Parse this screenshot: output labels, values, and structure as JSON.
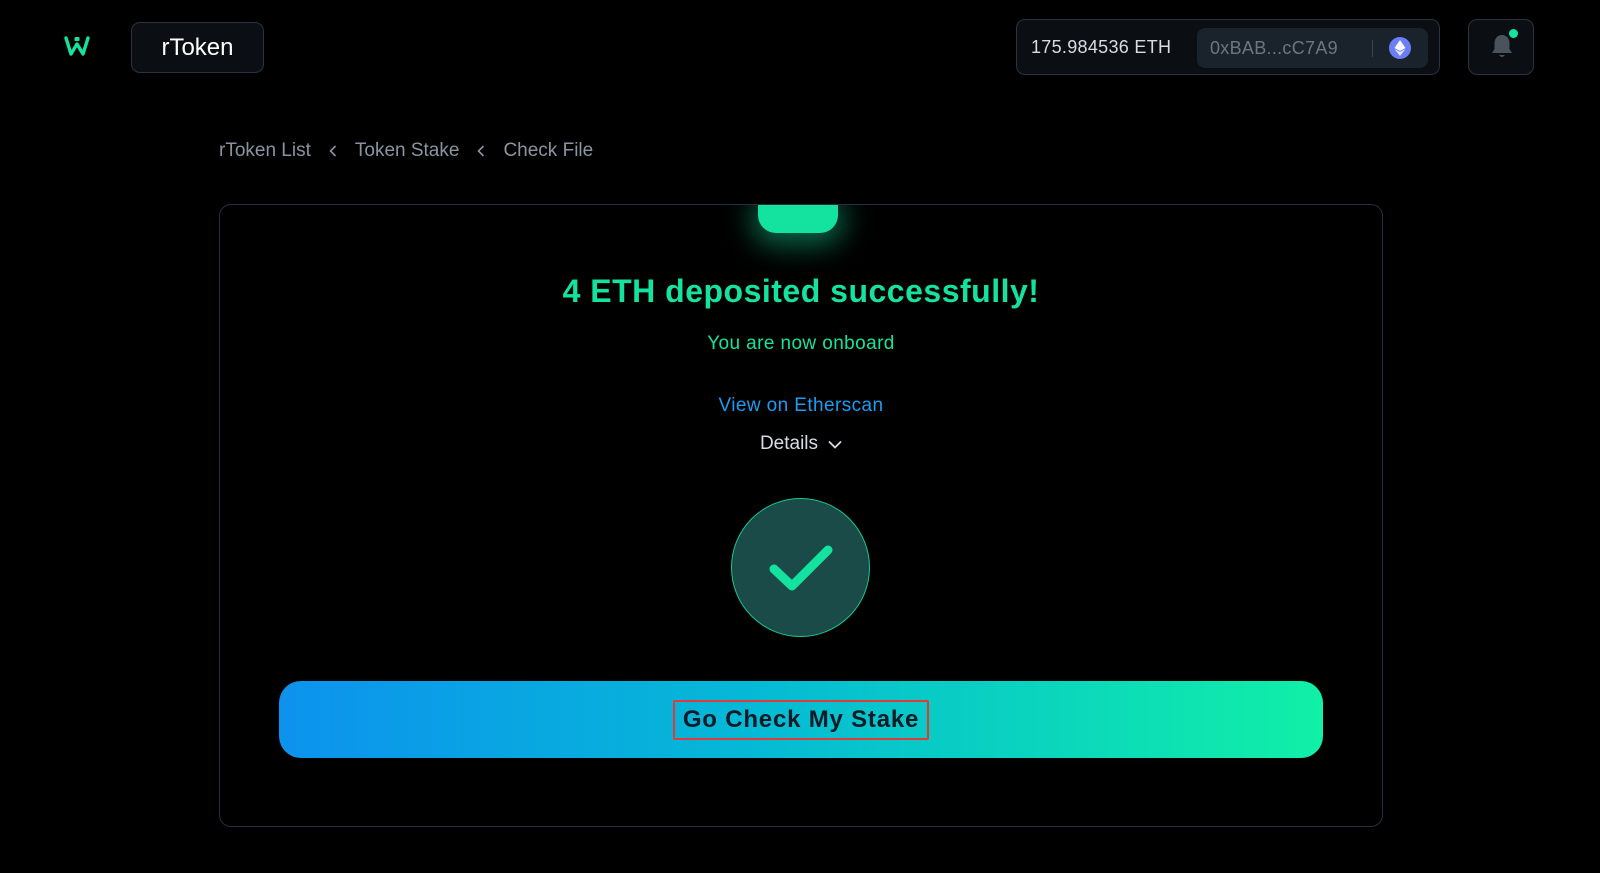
{
  "header": {
    "logo_icon": "w-logo-icon",
    "app_name": "rToken",
    "wallet": {
      "balance": "175.984536 ETH",
      "address": "0xBAB...cC7A9",
      "network_icon": "ethereum-icon"
    },
    "notification_icon": "bell-icon",
    "accent_color": "#14e3a0"
  },
  "breadcrumb": {
    "items": [
      "rToken List",
      "Token Stake",
      "Check File"
    ],
    "separator_icon": "chevron-left-icon"
  },
  "result_card": {
    "title": "4 ETH deposited successfully!",
    "subtitle": "You are now onboard",
    "explorer_link": "View on Etherscan",
    "details_label": "Details",
    "details_icon": "chevron-down-icon",
    "status_icon": "check-icon",
    "cta_label": "Go Check My Stake"
  },
  "colors": {
    "success": "#14e3a0",
    "link": "#1b9cf2",
    "cta_gradient_start": "#0d92ee",
    "cta_gradient_end": "#10f0a6"
  }
}
